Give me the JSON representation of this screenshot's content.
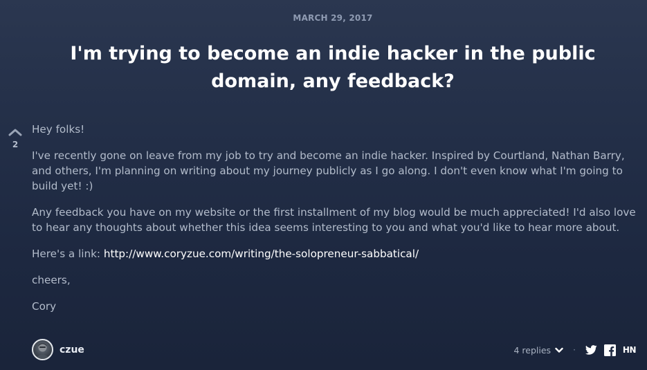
{
  "post": {
    "date": "MARCH 29, 2017",
    "title": "I'm trying to become an indie hacker in the public domain, any feedback?",
    "vote_count": "2",
    "paragraphs": [
      "Hey folks!",
      "I've recently gone on leave from my job to try and become an indie hacker. Inspired by Courtland, Nathan Barry, and others, I'm planning on writing about my journey publicly as I go along. I don't even know what I'm going to build yet! :)",
      "Any feedback you have on my website or the first installment of my blog would be much appreciated! I'd also love to hear any thoughts about whether this idea seems interesting to you and what you'd like to hear more about."
    ],
    "link_prefix": "Here's a link: ",
    "link_text": "http://www.coryzue.com/writing/the-solopreneur-sabbatical/",
    "closing": "cheers,",
    "signature": "Cory"
  },
  "footer": {
    "username": "czue",
    "replies_label": "4 replies",
    "separator": "·",
    "hn_label": "HN"
  },
  "icons": {
    "upvote": "chevron-up-icon",
    "replies_toggle": "chevron-down-icon",
    "twitter": "twitter-icon",
    "facebook": "facebook-icon",
    "hackernews": "hn-icon"
  },
  "colors": {
    "background": "#243049",
    "title": "#ffffff",
    "body_text": "#b3bccb",
    "link": "#ffffff",
    "meta": "#8f9bb2"
  }
}
